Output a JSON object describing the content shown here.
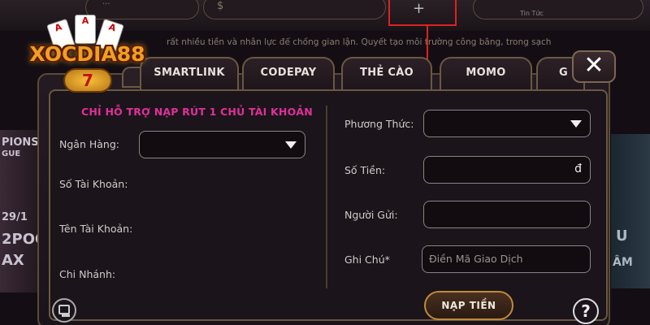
{
  "background": {
    "marquee": "rất nhiều tiền và nhân lực để chống gian lận. Quyết tạo môi trường công bằng, trong sạch",
    "tin_tuc": "Tin Tức",
    "top_small": "...",
    "dollar_icon": "$",
    "plus_icon": "+",
    "left_promo": [
      "PIONS",
      "GUE",
      "29/1",
      "2POO",
      "AX"
    ],
    "right_promo": [
      "U",
      "ÂM"
    ]
  },
  "logo": {
    "text": "XOCDIA88",
    "badge": "7",
    "cards": [
      "A",
      "A",
      "A"
    ]
  },
  "tabs": [
    {
      "label": "SMARTLINK"
    },
    {
      "label": "CODEPAY"
    },
    {
      "label": "THẺ CÀO"
    },
    {
      "label": "MOMO"
    },
    {
      "label": "G"
    }
  ],
  "close_icon": "✕",
  "notice": "CHỈ HỖ TRỢ NẠP RÚT 1 CHỦ TÀI KHOẢN",
  "left_form": {
    "bank_label": "Ngân Hàng:",
    "account_number_label": "Số Tài Khoản:",
    "account_name_label": "Tên Tài Khoản:",
    "branch_label": "Chi Nhánh:"
  },
  "right_form": {
    "method_label": "Phương Thức:",
    "amount_label": "Số Tiền:",
    "amount_currency": "đ",
    "sender_label": "Người Gửi:",
    "note_label": "Ghi Chú*",
    "note_placeholder": "Điền Mã Giao Dịch"
  },
  "submit_label": "NẠP TIỀN",
  "help_icon": "?",
  "colors": {
    "notice": "#e0309a",
    "annotation": "#dd2222",
    "border_gold": "#6a5842"
  }
}
